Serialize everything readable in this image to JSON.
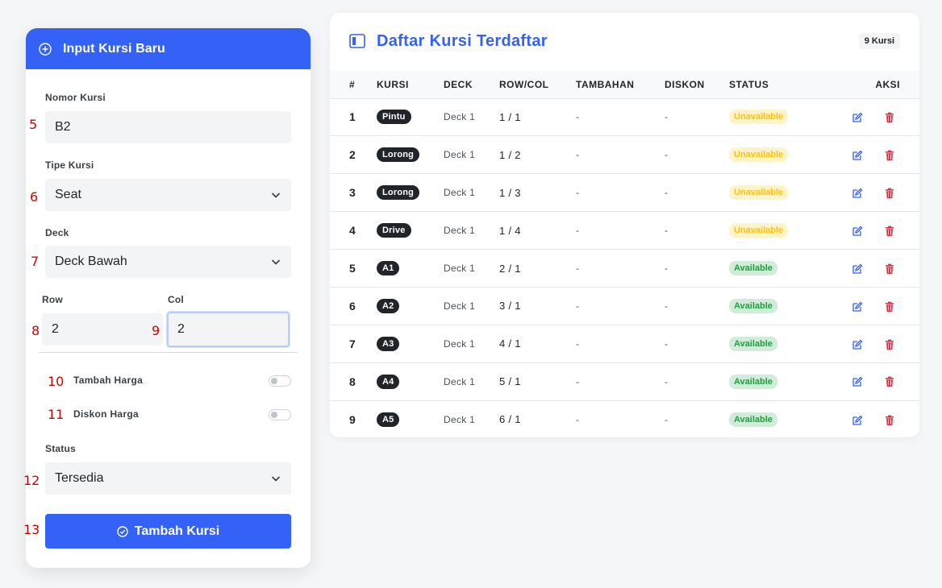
{
  "form": {
    "title": "Input Kursi Baru",
    "nomor_label": "Nomor Kursi",
    "nomor_value": "B2",
    "tipe_label": "Tipe Kursi",
    "tipe_value": "Seat",
    "deck_label": "Deck",
    "deck_value": "Deck Bawah",
    "row_label": "Row",
    "row_value": "2",
    "col_label": "Col",
    "col_value": "2",
    "tambah_label": "Tambah Harga",
    "diskon_label": "Diskon Harga",
    "status_label": "Status",
    "status_value": "Tersedia",
    "submit_label": "Tambah Kursi"
  },
  "markers": {
    "m5": "5",
    "m6": "6",
    "m7": "7",
    "m8": "8",
    "m9": "9",
    "m10": "10",
    "m11": "11",
    "m12": "12",
    "m13": "13"
  },
  "table": {
    "title": "Daftar Kursi Terdaftar",
    "count": "9 Kursi",
    "headers": {
      "no": "#",
      "kursi": "KURSI",
      "deck": "DECK",
      "rowcol": "ROW/COL",
      "tambahan": "TAMBAHAN",
      "diskon": "DISKON",
      "status": "STATUS",
      "aksi": "AKSI"
    },
    "rows": [
      {
        "no": "1",
        "kursi": "Pintu",
        "deck": "Deck 1",
        "rowcol": "1 / 1",
        "tambahan": "-",
        "diskon": "-",
        "status": "Unavailable"
      },
      {
        "no": "2",
        "kursi": "Lorong",
        "deck": "Deck 1",
        "rowcol": "1 / 2",
        "tambahan": "-",
        "diskon": "-",
        "status": "Unavailable"
      },
      {
        "no": "3",
        "kursi": "Lorong",
        "deck": "Deck 1",
        "rowcol": "1 / 3",
        "tambahan": "-",
        "diskon": "-",
        "status": "Unavailable"
      },
      {
        "no": "4",
        "kursi": "Drive",
        "deck": "Deck 1",
        "rowcol": "1 / 4",
        "tambahan": "-",
        "diskon": "-",
        "status": "Unavailable"
      },
      {
        "no": "5",
        "kursi": "A1",
        "deck": "Deck 1",
        "rowcol": "2 / 1",
        "tambahan": "-",
        "diskon": "-",
        "status": "Available"
      },
      {
        "no": "6",
        "kursi": "A2",
        "deck": "Deck 1",
        "rowcol": "3 / 1",
        "tambahan": "-",
        "diskon": "-",
        "status": "Available"
      },
      {
        "no": "7",
        "kursi": "A3",
        "deck": "Deck 1",
        "rowcol": "4 / 1",
        "tambahan": "-",
        "diskon": "-",
        "status": "Available"
      },
      {
        "no": "8",
        "kursi": "A4",
        "deck": "Deck 1",
        "rowcol": "5 / 1",
        "tambahan": "-",
        "diskon": "-",
        "status": "Available"
      },
      {
        "no": "9",
        "kursi": "A5",
        "deck": "Deck 1",
        "rowcol": "6 / 1",
        "tambahan": "-",
        "diskon": "-",
        "status": "Available"
      }
    ]
  },
  "colors": {
    "primary": "#3461f6",
    "unavailable_text": "#ffc107",
    "available_text": "#1e9e3e",
    "delete_icon": "#dc3545",
    "marker": "#d40000"
  }
}
